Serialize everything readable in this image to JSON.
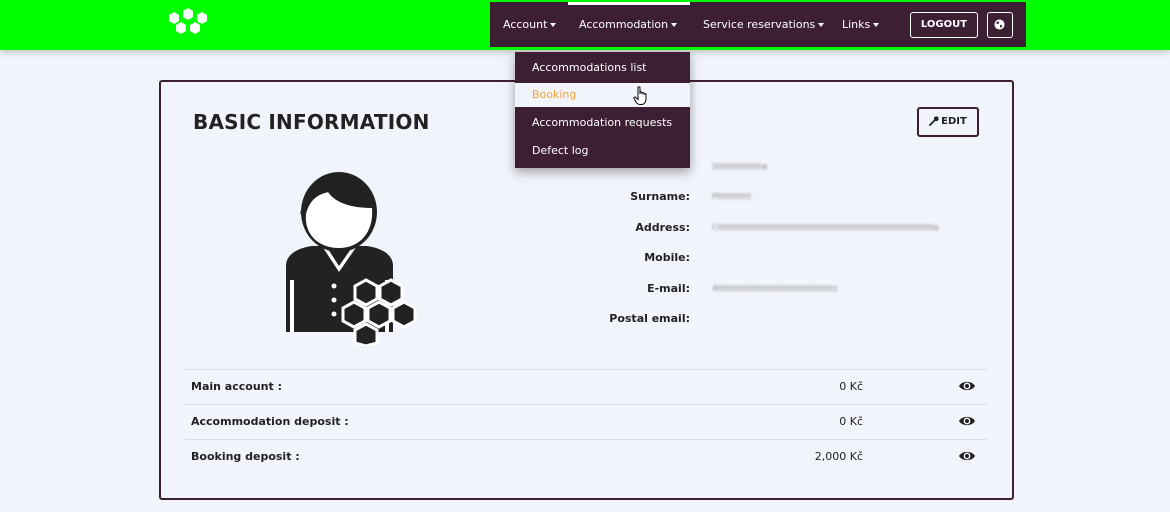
{
  "nav": {
    "items": [
      {
        "label": "Account"
      },
      {
        "label": "Accommodation"
      },
      {
        "label": "Service reservations"
      },
      {
        "label": "Links"
      }
    ],
    "logout_label": "LOGOUT"
  },
  "dropdown": {
    "items": [
      {
        "label": "Accommodations list"
      },
      {
        "label": "Booking"
      },
      {
        "label": "Accommodation requests"
      },
      {
        "label": "Defect log"
      }
    ]
  },
  "basic_info": {
    "title": "BASIC INFORMATION",
    "edit_label": "EDIT",
    "fields": [
      {
        "label": "",
        "value": "Sttttttttttttttw"
      },
      {
        "label": "Surname:",
        "value": "Pttttttttttt"
      },
      {
        "label": "Address:",
        "value": "Cttttttttttttttttttttttttttttttttttttttttttttttttttttttttttttttttttttte"
      },
      {
        "label": "Mobile:",
        "value": ""
      },
      {
        "label": "E-mail:",
        "value": "4tttttttttttttttttttttttttttttttttttttz"
      },
      {
        "label": "Postal email:",
        "value": ""
      }
    ]
  },
  "accounts": [
    {
      "label": "Main account :",
      "amount": "0 Kč"
    },
    {
      "label": "Accommodation deposit :",
      "amount": "0 Kč"
    },
    {
      "label": "Booking deposit :",
      "amount": "2,000 Kč"
    }
  ],
  "icons": {
    "logo": "hexagon-cluster-logo",
    "edit": "wrench-icon",
    "language": "globe-icon",
    "account_view": "eye-icon",
    "avatar": "user-avatar-with-hexagons"
  },
  "colors": {
    "topbar_bg": "#00ff00",
    "nav_bg": "#3d1f33",
    "page_bg": "#f2f4fb",
    "dropdown_hover_text": "#f2a33a"
  }
}
